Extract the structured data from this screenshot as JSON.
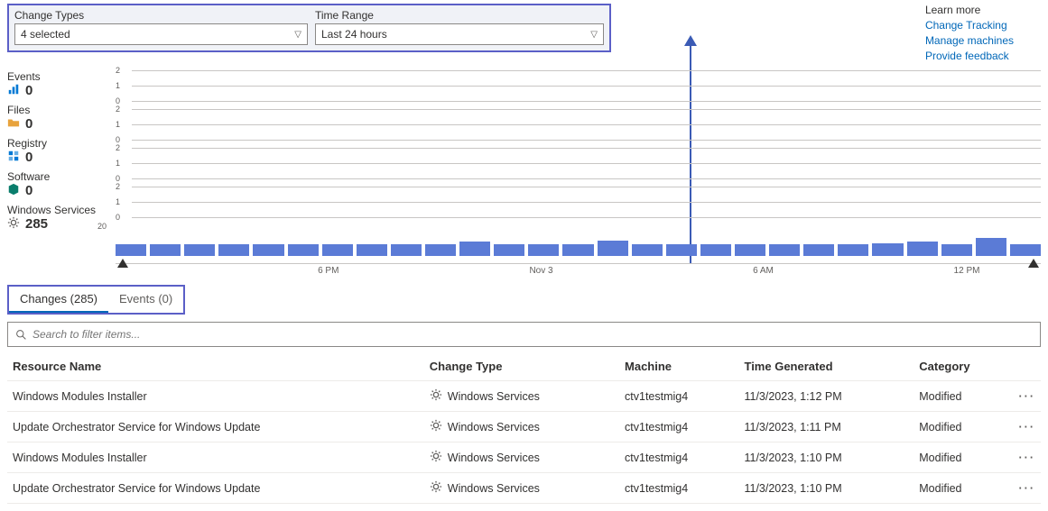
{
  "filters": {
    "change_types_label": "Change Types",
    "change_types_value": "4 selected",
    "time_range_label": "Time Range",
    "time_range_value": "Last 24 hours"
  },
  "learn": {
    "title": "Learn more",
    "links": [
      "Change Tracking",
      "Manage machines",
      "Provide feedback"
    ]
  },
  "categories": [
    {
      "label": "Events",
      "count": "0",
      "icon": "chart-icon",
      "color": "#0078d4"
    },
    {
      "label": "Files",
      "count": "0",
      "icon": "folder-icon",
      "color": "#e8a33d"
    },
    {
      "label": "Registry",
      "count": "0",
      "icon": "registry-icon",
      "color": "#0078d4"
    },
    {
      "label": "Software",
      "count": "0",
      "icon": "package-icon",
      "color": "#0a7d6c"
    },
    {
      "label": "Windows Services",
      "count": "285",
      "icon": "gear-icon",
      "color": "#605e5c"
    }
  ],
  "chart_data": {
    "small_rows": [
      {
        "ticks": [
          "2",
          "1",
          "0"
        ]
      },
      {
        "ticks": [
          "2",
          "1",
          "0"
        ]
      },
      {
        "ticks": [
          "2",
          "1",
          "0"
        ]
      },
      {
        "ticks": [
          "2",
          "1",
          "0"
        ]
      }
    ],
    "big": {
      "y_tick": "20",
      "x_labels": [
        "6 PM",
        "Nov 3",
        "6 AM",
        "12 PM"
      ],
      "bars": [
        10,
        10,
        10,
        10,
        10,
        10,
        10,
        10,
        10,
        10,
        12,
        10,
        10,
        10,
        13,
        10,
        10,
        10,
        10,
        10,
        10,
        10,
        11,
        12,
        10,
        15,
        10
      ]
    }
  },
  "tabs": {
    "changes_label": "Changes (285)",
    "events_label": "Events (0)"
  },
  "search": {
    "placeholder": "Search to filter items..."
  },
  "table": {
    "headers": [
      "Resource Name",
      "Change Type",
      "Machine",
      "Time Generated",
      "Category"
    ],
    "rows": [
      {
        "name": "Windows Modules Installer",
        "type": "Windows Services",
        "machine": "ctv1testmig4",
        "time": "11/3/2023, 1:12 PM",
        "cat": "Modified"
      },
      {
        "name": "Update Orchestrator Service for Windows Update",
        "type": "Windows Services",
        "machine": "ctv1testmig4",
        "time": "11/3/2023, 1:11 PM",
        "cat": "Modified"
      },
      {
        "name": "Windows Modules Installer",
        "type": "Windows Services",
        "machine": "ctv1testmig4",
        "time": "11/3/2023, 1:10 PM",
        "cat": "Modified"
      },
      {
        "name": "Update Orchestrator Service for Windows Update",
        "type": "Windows Services",
        "machine": "ctv1testmig4",
        "time": "11/3/2023, 1:10 PM",
        "cat": "Modified"
      }
    ]
  }
}
